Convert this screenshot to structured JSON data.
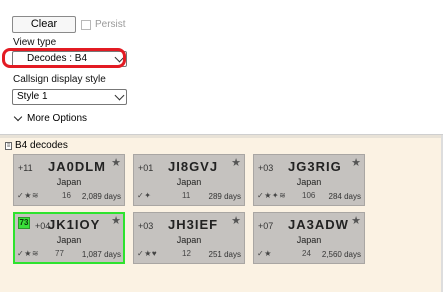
{
  "options": {
    "clear_label": "Clear",
    "persist_label": "Persist",
    "view_type_label": "View type",
    "view_type_value": "Decodes : B4",
    "callsign_style_label": "Callsign display style",
    "callsign_style_value": "Style 1",
    "more_options_label": "More Options"
  },
  "decodes": {
    "header": "B4 decodes",
    "cards": [
      {
        "db": "+11",
        "callsign": "JA0DLM",
        "country": "Japan",
        "icons": "✓★≋",
        "count": "16",
        "days": "2,089 days",
        "selected": false,
        "slot": ""
      },
      {
        "db": "+01",
        "callsign": "JI8GVJ",
        "country": "Japan",
        "icons": "✓✦",
        "count": "11",
        "days": "289 days",
        "selected": false,
        "slot": ""
      },
      {
        "db": "+03",
        "callsign": "JG3RIG",
        "country": "Japan",
        "icons": "✓★✦≋",
        "count": "106",
        "days": "284 days",
        "selected": false,
        "slot": ""
      },
      {
        "db": "+04",
        "callsign": "JK1IOY",
        "country": "Japan",
        "icons": "✓★≋",
        "count": "77",
        "days": "1,087 days",
        "selected": true,
        "slot": "73"
      },
      {
        "db": "+03",
        "callsign": "JH3IEF",
        "country": "Japan",
        "icons": "✓★♥",
        "count": "12",
        "days": "251 days",
        "selected": false,
        "slot": ""
      },
      {
        "db": "+07",
        "callsign": "JA3ADW",
        "country": "Japan",
        "icons": "✓★",
        "count": "24",
        "days": "2,560 days",
        "selected": false,
        "slot": ""
      }
    ]
  }
}
